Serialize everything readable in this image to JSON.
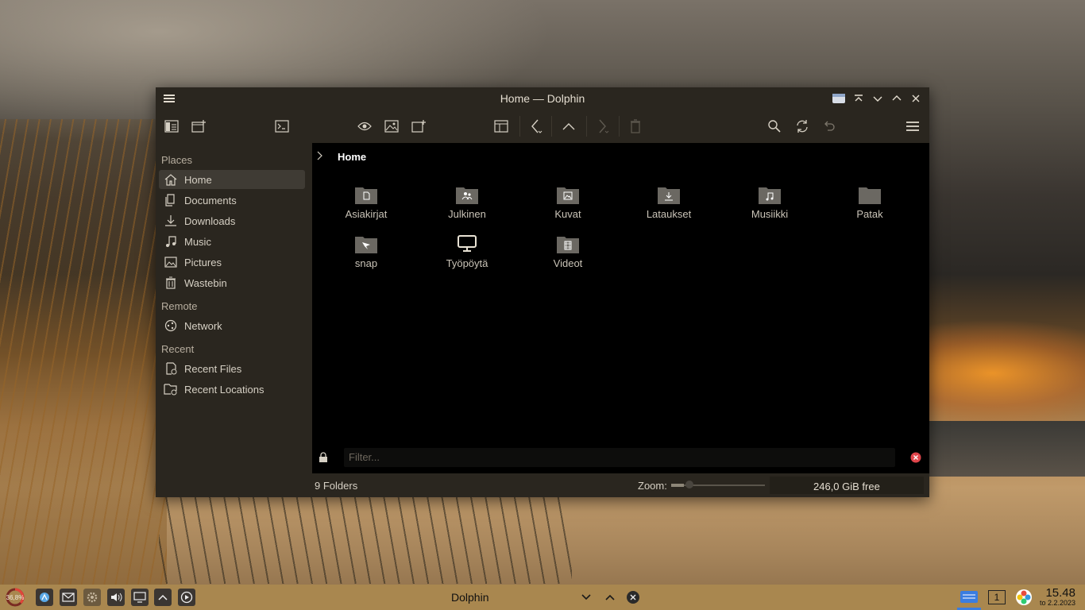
{
  "window": {
    "title": "Home — Dolphin"
  },
  "sidebar": {
    "sections": [
      {
        "label": "Places",
        "items": [
          {
            "label": "Home",
            "icon": "home-icon",
            "active": true
          },
          {
            "label": "Documents",
            "icon": "documents-icon"
          },
          {
            "label": "Downloads",
            "icon": "downloads-icon"
          },
          {
            "label": "Music",
            "icon": "music-icon"
          },
          {
            "label": "Pictures",
            "icon": "pictures-icon"
          },
          {
            "label": "Wastebin",
            "icon": "wastebin-icon"
          }
        ]
      },
      {
        "label": "Remote",
        "items": [
          {
            "label": "Network",
            "icon": "network-icon"
          }
        ]
      },
      {
        "label": "Recent",
        "items": [
          {
            "label": "Recent Files",
            "icon": "recent-files-icon"
          },
          {
            "label": "Recent Locations",
            "icon": "recent-locations-icon"
          }
        ]
      }
    ]
  },
  "breadcrumb": {
    "current": "Home"
  },
  "files": [
    {
      "name": "Asiakirjat",
      "icon": "folder-documents-icon"
    },
    {
      "name": "Julkinen",
      "icon": "folder-public-icon"
    },
    {
      "name": "Kuvat",
      "icon": "folder-pictures-icon"
    },
    {
      "name": "Lataukset",
      "icon": "folder-downloads-icon"
    },
    {
      "name": "Musiikki",
      "icon": "folder-music-icon"
    },
    {
      "name": "Patak",
      "icon": "folder-icon"
    },
    {
      "name": "snap",
      "icon": "folder-snap-icon"
    },
    {
      "name": "Työpöytä",
      "icon": "desktop-icon"
    },
    {
      "name": "Videot",
      "icon": "folder-videos-icon"
    }
  ],
  "filter": {
    "placeholder": "Filter..."
  },
  "status": {
    "count": "9 Folders",
    "zoom_label": "Zoom:",
    "free": "246,0 GiB free"
  },
  "taskbar": {
    "cpu": "36,8%",
    "task_title": "Dolphin",
    "desktop_number": "1",
    "time": "15.48",
    "date": "to 2.2.2023"
  },
  "colors": {
    "accent": "#a9874f",
    "window_bg": "#2a261f",
    "folder": "#6b6862"
  }
}
